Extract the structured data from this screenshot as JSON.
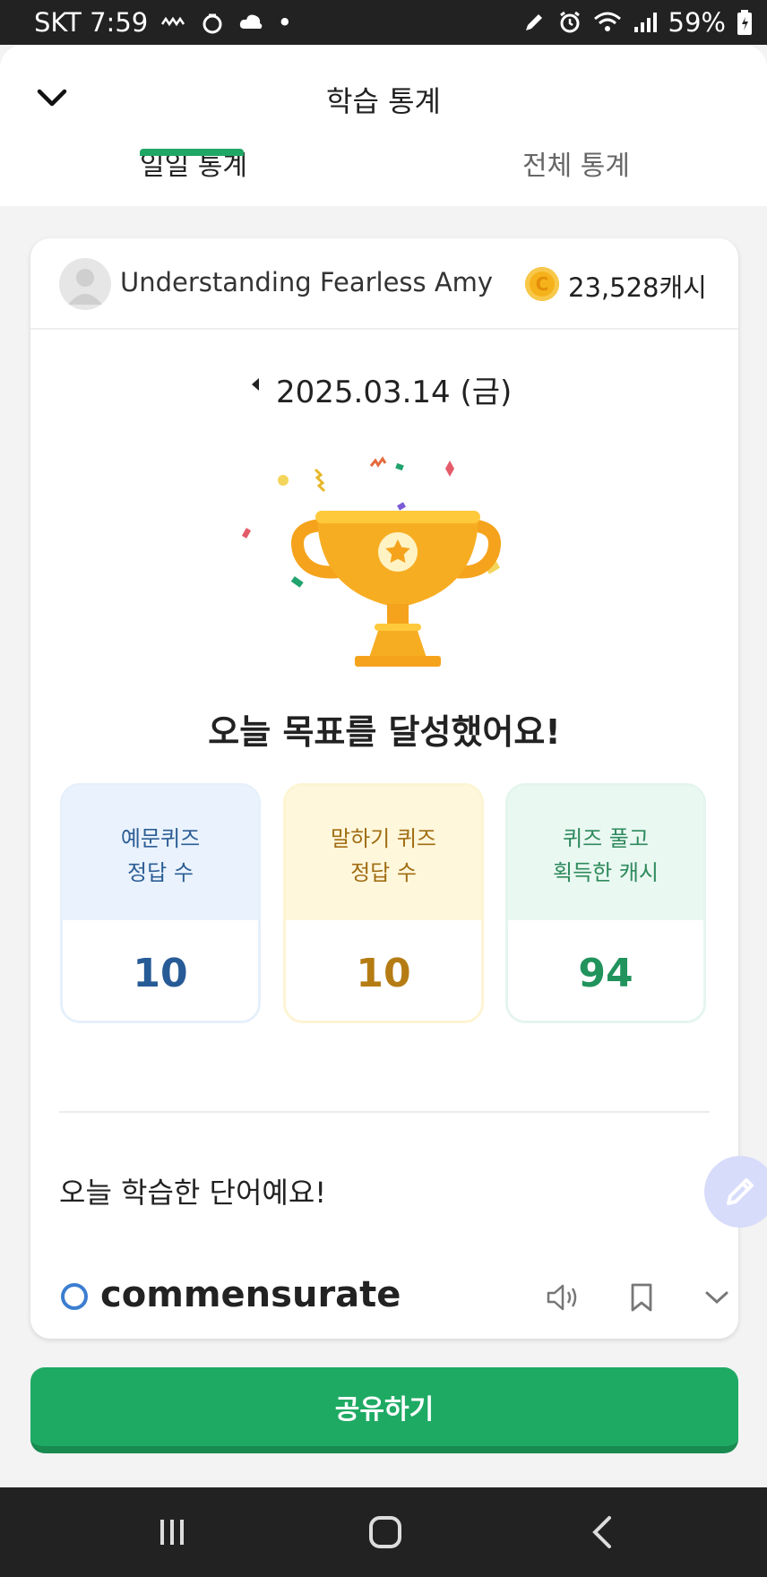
{
  "status_bar": {
    "carrier_time": "SKT 7:59",
    "dot": "•",
    "battery": "59%"
  },
  "header": {
    "title": "학습 통계",
    "tabs": [
      {
        "label": "일일 통계",
        "active": true
      },
      {
        "label": "전체 통계",
        "active": false
      }
    ]
  },
  "profile": {
    "username": "Understanding Fearless Amy",
    "cash": "23,528캐시"
  },
  "date": {
    "text": "2025.03.14 (금)"
  },
  "headline": "오늘 목표를 달성했어요!",
  "stats": [
    {
      "label_line1": "예문퀴즈",
      "label_line2": "정답 수",
      "value": "10"
    },
    {
      "label_line1": "말하기 퀴즈",
      "label_line2": "정답 수",
      "value": "10"
    },
    {
      "label_line1": "퀴즈 풀고",
      "label_line2": "획득한 캐시",
      "value": "94"
    }
  ],
  "words_section": {
    "title": "오늘 학습한 단어예요!",
    "items": [
      {
        "word": "commensurate"
      }
    ]
  },
  "share_button": "공유하기",
  "colors": {
    "accent_green": "#1faa64",
    "word_circle": "#3c7ed1",
    "coin": "#f6b21b"
  }
}
